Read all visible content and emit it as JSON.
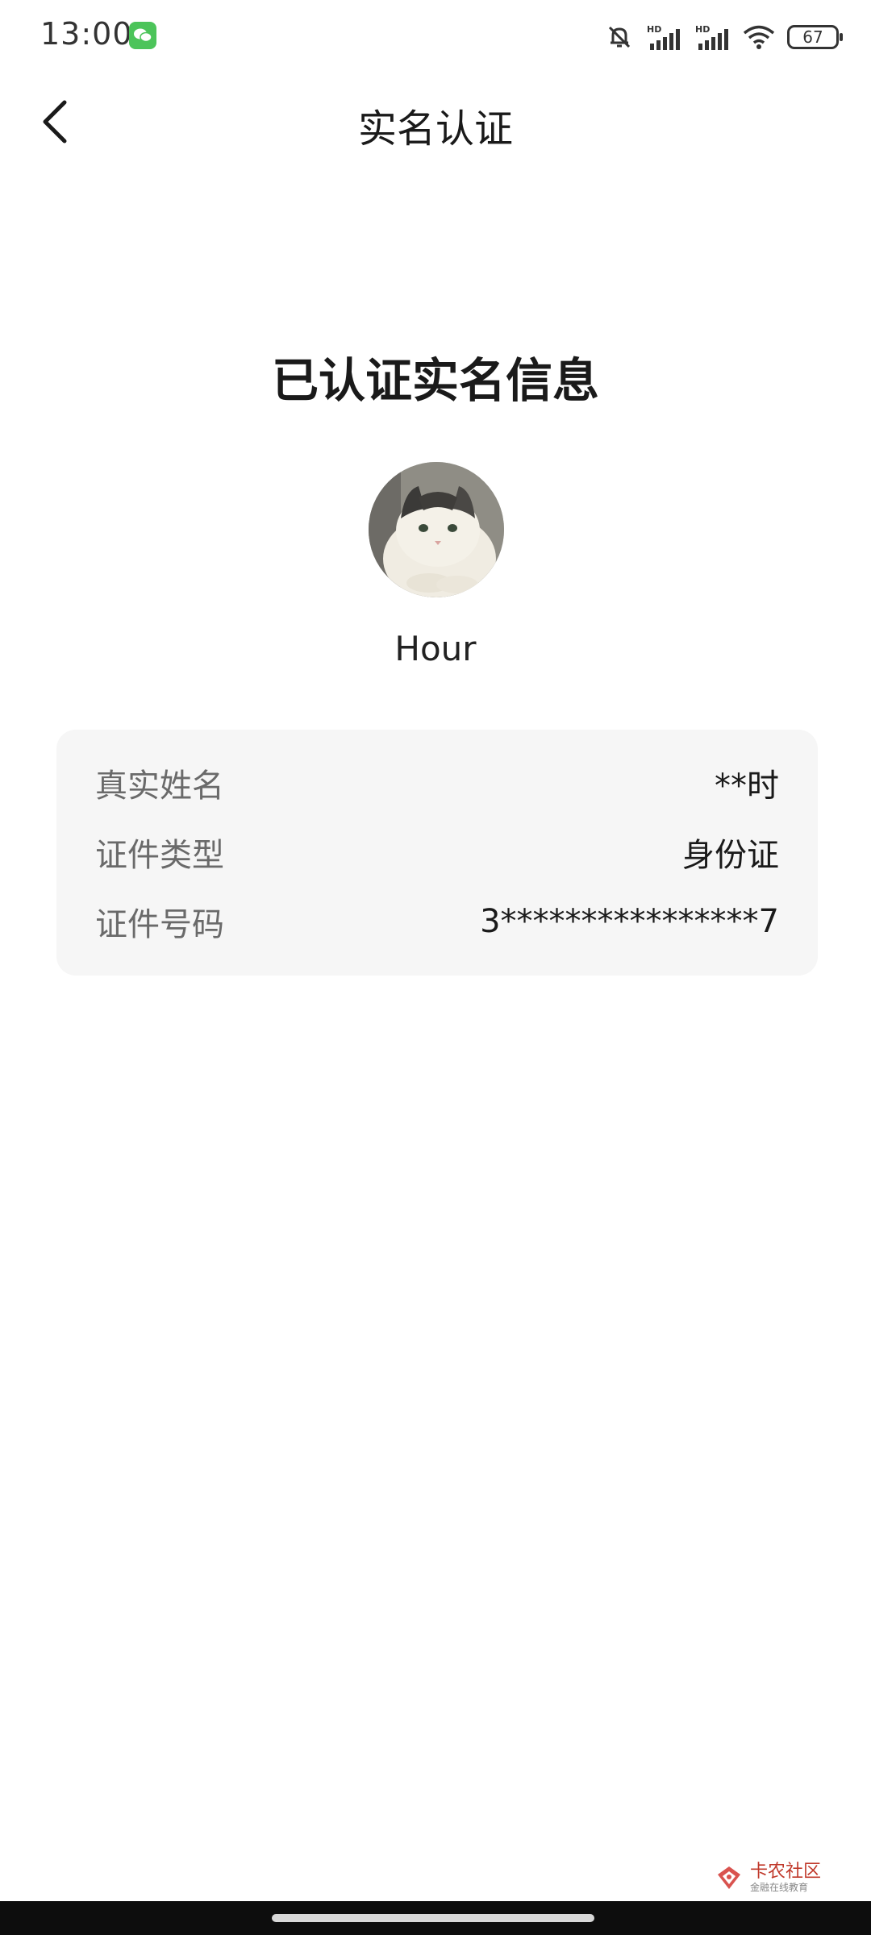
{
  "status_bar": {
    "time": "13:00",
    "battery": "67",
    "icons": [
      "wechat-icon",
      "mute-bell-icon",
      "hd-signal-icon",
      "hd-signal-icon",
      "wifi-icon",
      "battery-icon"
    ]
  },
  "nav": {
    "title": "实名认证",
    "back_icon": "chevron-left-icon"
  },
  "main": {
    "heading": "已认证实名信息",
    "username": "Hour"
  },
  "info": {
    "rows": [
      {
        "label": "真实姓名",
        "value": "**时"
      },
      {
        "label": "证件类型",
        "value": "身份证"
      },
      {
        "label": "证件号码",
        "value": "3****************7"
      }
    ]
  },
  "watermark": {
    "main": "卡农社区",
    "sub": "金融在线教育"
  }
}
